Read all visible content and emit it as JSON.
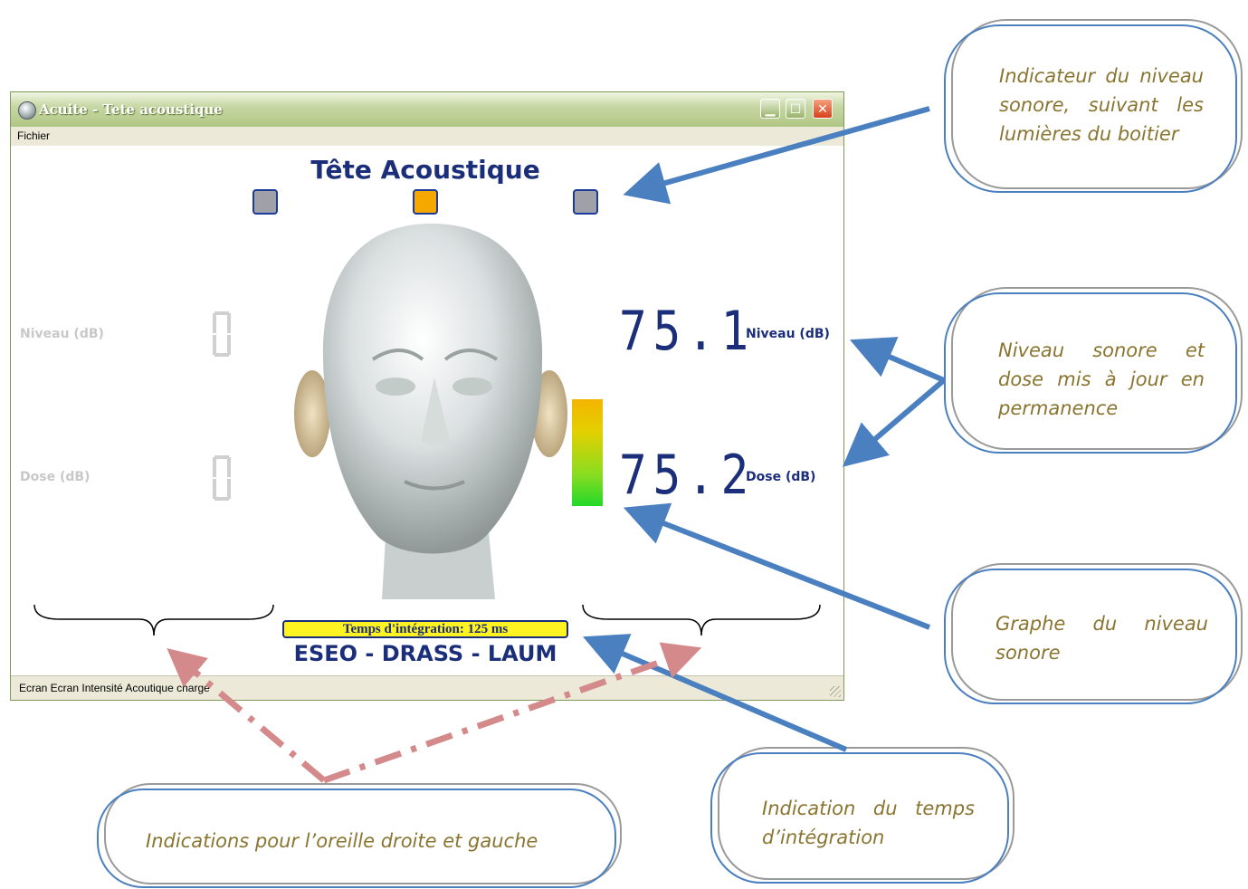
{
  "window": {
    "title": "Acuite - Tete acoustique",
    "menu": [
      "Fichier"
    ],
    "status": "Ecran Ecran Intensité Acoutique chargé"
  },
  "app": {
    "title": "Tête Acoustique",
    "lights": [
      "#a0a0a8",
      "#f5a800",
      "#a0a0a8"
    ],
    "left": {
      "niveau_label": "Niveau (dB)",
      "dose_label": "Dose (dB)"
    },
    "right": {
      "niveau_label": "Niveau (dB)",
      "niveau_value": "75.1",
      "dose_label": "Dose (dB)",
      "dose_value": "75.2"
    },
    "integration": "Temps d'intégration: 125 ms",
    "credits": "ESEO - DRASS - LAUM"
  },
  "colors": {
    "accent": "#1b2e7a",
    "arrow": "#4a7fc0",
    "dashed_arrow": "#d48a8a",
    "callout_text": "#8a7530"
  },
  "callouts": {
    "lights": "Indicateur du niveau sonore, suivant les lumières du boitier",
    "niveau": "Niveau sonore et dose mis à jour en permanence",
    "graphe": "Graphe du niveau sonore",
    "integration": "Indication du temps d’intégration",
    "oreilles": "Indications pour l’oreille droite et gauche"
  }
}
